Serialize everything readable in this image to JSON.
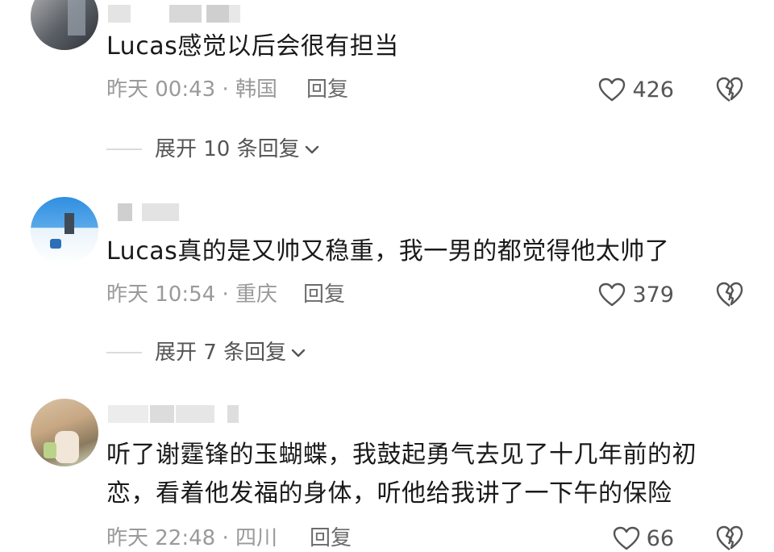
{
  "comments": [
    {
      "text": "Lucas感觉以后会很有担当",
      "time": "昨天 00:43 · 韩国",
      "reply_label": "回复",
      "likes": "426",
      "expand_label": "展开 10 条回复"
    },
    {
      "text": "Lucas真的是又帅又稳重，我一男的都觉得他太帅了",
      "time": "昨天 10:54 · 重庆",
      "reply_label": "回复",
      "likes": "379",
      "expand_label": "展开 7 条回复"
    },
    {
      "text": "听了谢霆锋的玉蝴蝶，我鼓起勇气去见了十几年前的初恋，看着他发福的身体，听他给我讲了一下午的保险",
      "time": "昨天 22:48 · 四川",
      "reply_label": "回复",
      "likes": "66"
    }
  ],
  "icons": {
    "like": "heart-outline-icon",
    "dislike": "broken-heart-icon",
    "expand": "chevron-down-icon"
  },
  "colors": {
    "text": "#1a1a1a",
    "meta": "#9a9a9a",
    "background": "#ffffff"
  }
}
